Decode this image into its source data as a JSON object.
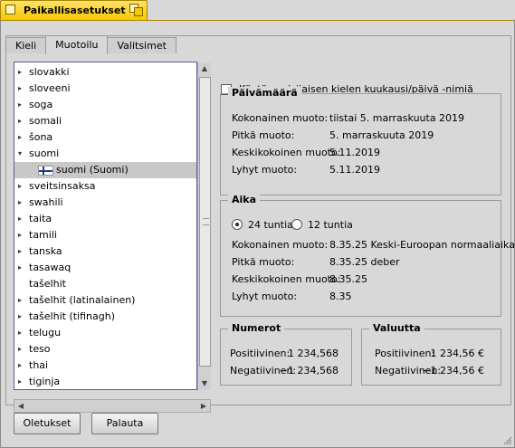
{
  "window": {
    "title": "Paikallisasetukset"
  },
  "tabs": [
    {
      "label": "Kieli"
    },
    {
      "label": "Muotoilu"
    },
    {
      "label": "Valitsimet"
    }
  ],
  "language_list": {
    "items": [
      {
        "label": "slovakki",
        "state": "collapsed"
      },
      {
        "label": "sloveeni",
        "state": "collapsed"
      },
      {
        "label": "soga",
        "state": "collapsed"
      },
      {
        "label": "somali",
        "state": "collapsed"
      },
      {
        "label": "šona",
        "state": "collapsed"
      },
      {
        "label": "suomi",
        "state": "expanded"
      },
      {
        "label": "suomi (Suomi)",
        "state": "child",
        "selected": true,
        "icon": "finland-flag-icon"
      },
      {
        "label": "sveitsinsaksa",
        "state": "collapsed"
      },
      {
        "label": "swahili",
        "state": "collapsed"
      },
      {
        "label": "taita",
        "state": "collapsed"
      },
      {
        "label": "tamili",
        "state": "collapsed"
      },
      {
        "label": "tanska",
        "state": "collapsed"
      },
      {
        "label": "tasawaq",
        "state": "collapsed"
      },
      {
        "label": "tašelhit",
        "state": "leaf"
      },
      {
        "label": "tašelhit (latinalainen)",
        "state": "collapsed"
      },
      {
        "label": "tašelhit (tifinagh)",
        "state": "collapsed"
      },
      {
        "label": "telugu",
        "state": "collapsed"
      },
      {
        "label": "teso",
        "state": "collapsed"
      },
      {
        "label": "thai",
        "state": "collapsed"
      },
      {
        "label": "tiginja",
        "state": "collapsed"
      }
    ]
  },
  "options": {
    "use_language_month_names": "Käytä ensisijaisen kielen kuukausi/päivä -nimiä"
  },
  "date": {
    "title": "Päivämäärä",
    "rows": [
      {
        "label": "Kokonainen muoto:",
        "value": "tiistai 5. marraskuuta 2019"
      },
      {
        "label": "Pitkä muoto:",
        "value": "5. marraskuuta 2019"
      },
      {
        "label": "Keskikokoinen muoto:",
        "value": "5.11.2019"
      },
      {
        "label": "Lyhyt muoto:",
        "value": "5.11.2019"
      }
    ]
  },
  "time": {
    "title": "Aika",
    "radio_24": "24 tuntia",
    "radio_12": "12 tuntia",
    "rows": [
      {
        "label": "Kokonainen muoto:",
        "value": "8.35.25 Keski-Euroopan normaaliaika"
      },
      {
        "label": "Pitkä muoto:",
        "value": "8.35.25 deber"
      },
      {
        "label": "Keskikokoinen muoto:",
        "value": "8.35.25"
      },
      {
        "label": "Lyhyt muoto:",
        "value": "8.35"
      }
    ]
  },
  "numbers": {
    "title": "Numerot",
    "positive_label": "Positiivinen:",
    "positive_value": "1 234,568",
    "negative_label": "Negatiivinen:",
    "negative_value": "−1 234,568"
  },
  "currency": {
    "title": "Valuutta",
    "positive_label": "Positiivinen:",
    "positive_value": "1 234,56 €",
    "negative_label": "Negatiivinen:",
    "negative_value": "−1 234,56 €"
  },
  "buttons": {
    "defaults": "Oletukset",
    "revert": "Palauta"
  }
}
